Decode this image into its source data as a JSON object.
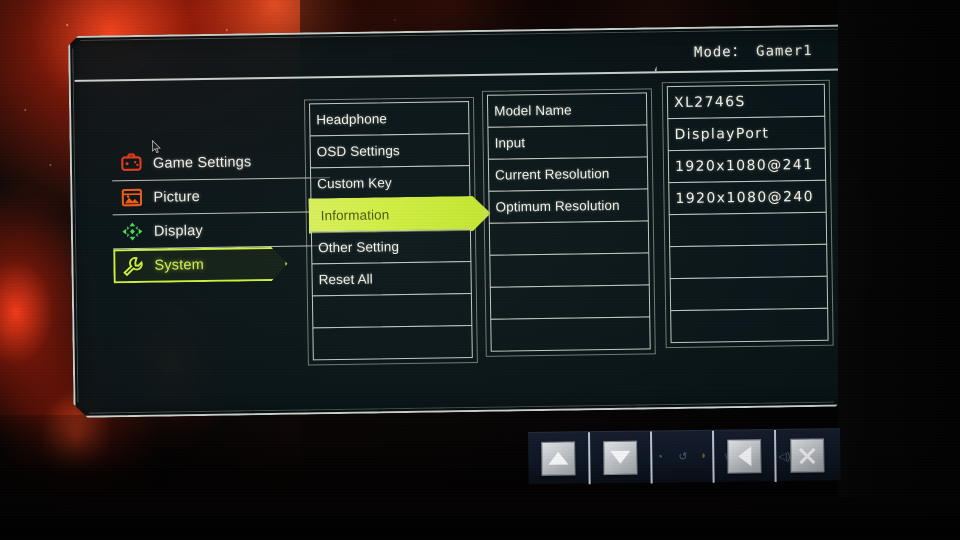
{
  "header": {
    "mode_label": "Mode：",
    "mode_value": "Gamer1",
    "mode_full": "Mode： Gamer1"
  },
  "sidebar": {
    "items": [
      {
        "label": "Game Settings",
        "icon": "gamepad-icon",
        "color": "#e8381c",
        "selected": false
      },
      {
        "label": "Picture",
        "icon": "picture-icon",
        "color": "#ef5a12",
        "selected": false
      },
      {
        "label": "Display",
        "icon": "expand-icon",
        "color": "#4fd65a",
        "selected": false
      },
      {
        "label": "System",
        "icon": "wrench-icon",
        "color": "#cdf03a",
        "selected": true
      }
    ]
  },
  "menu_column": {
    "items": [
      {
        "label": "Headphone",
        "highlighted": false
      },
      {
        "label": "OSD Settings",
        "highlighted": false
      },
      {
        "label": "Custom Key",
        "highlighted": false
      },
      {
        "label": "Information",
        "highlighted": true
      },
      {
        "label": "Other Setting",
        "highlighted": false
      },
      {
        "label": "Reset All",
        "highlighted": false
      },
      {
        "label": "",
        "highlighted": false
      },
      {
        "label": "",
        "highlighted": false
      }
    ]
  },
  "info_labels": {
    "items": [
      {
        "label": "Model Name"
      },
      {
        "label": "Input"
      },
      {
        "label": "Current Resolution"
      },
      {
        "label": "Optimum Resolution"
      },
      {
        "label": ""
      },
      {
        "label": ""
      },
      {
        "label": ""
      },
      {
        "label": ""
      }
    ]
  },
  "info_values": {
    "items": [
      {
        "label": "XL2746S"
      },
      {
        "label": "DisplayPort"
      },
      {
        "label": "1920x1080@241"
      },
      {
        "label": "1920x1080@240"
      },
      {
        "label": ""
      },
      {
        "label": ""
      },
      {
        "label": ""
      },
      {
        "label": ""
      }
    ]
  },
  "button_bar": {
    "buttons": [
      {
        "name": "up-button",
        "icon": "triangle-up-icon"
      },
      {
        "name": "down-button",
        "icon": "triangle-down-icon"
      },
      {
        "name": "blank-button",
        "icon": "none"
      },
      {
        "name": "back-button",
        "icon": "triangle-left-icon"
      },
      {
        "name": "close-button",
        "icon": "close-x-icon"
      }
    ]
  },
  "colors": {
    "osd_border": "#c9cfc9",
    "osd_background": "#0a1418",
    "highlight": "#cdee3e",
    "highlight_text": "#4a5608",
    "text": "#f2f1e8",
    "accent_red": "#e8381c",
    "accent_orange": "#ef5a12",
    "accent_green": "#4fd65a",
    "accent_lime": "#cdf03a"
  }
}
